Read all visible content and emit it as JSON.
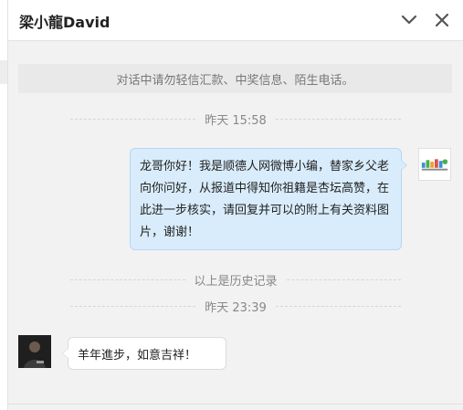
{
  "window": {
    "title": "梁小龍David",
    "collapse_icon": "chevron-down-icon",
    "close_icon": "close-icon"
  },
  "notice": {
    "text": "对话中请勿轻信汇款、中奖信息、陌生电话。"
  },
  "messages": [
    {
      "timestamp": "昨天 15:58",
      "sender": "self",
      "text": "龙哥你好！我是顺德人网微博小编，替家乡父老向你问好，从报道中得知你祖籍是杏坛高赞，在此进一步核实，请回复并可以的附上有关资料图片，谢谢！"
    },
    {
      "timestamp": "昨天 23:39",
      "sender": "other",
      "text": "羊年進步，如意吉祥！"
    }
  ],
  "history_marker": "以上是历史记录",
  "colors": {
    "self_bubble": "#d9ecfb",
    "self_bubble_border": "#b6d6f3",
    "other_bubble": "#ffffff",
    "background": "#f2f2f2"
  }
}
